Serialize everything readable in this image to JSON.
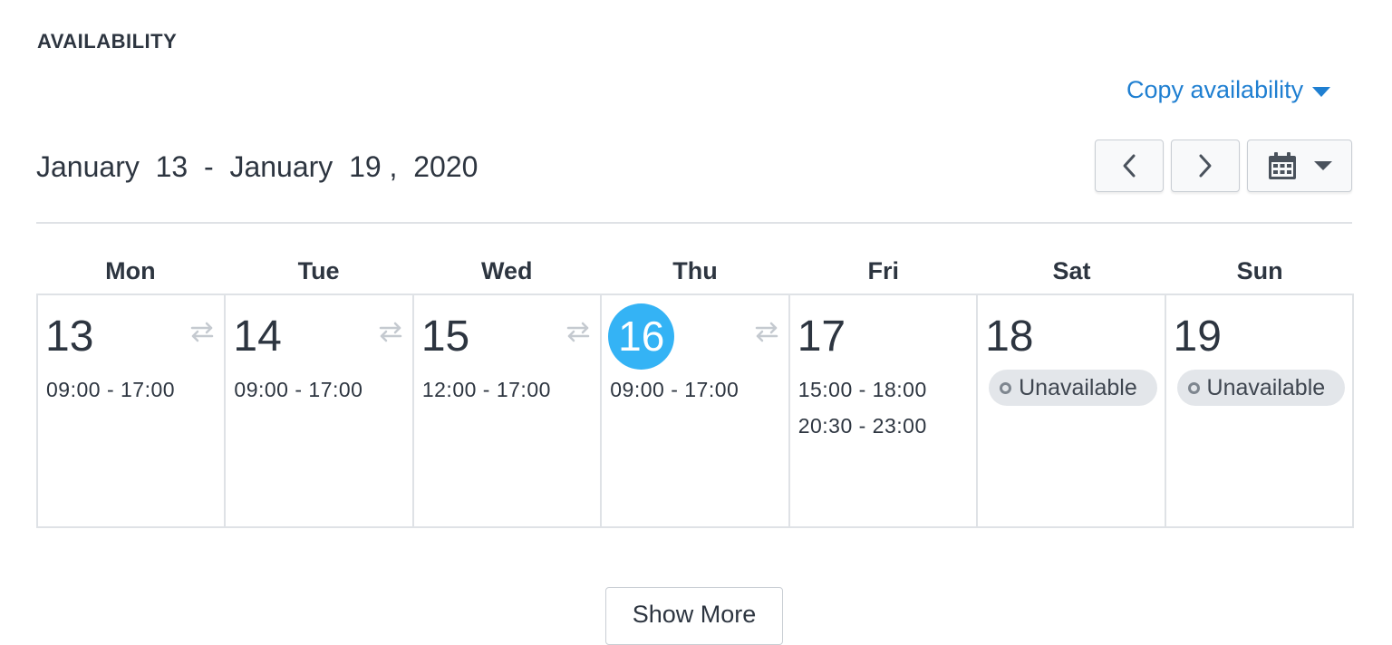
{
  "section_title": "AVAILABILITY",
  "copy_link": {
    "label": "Copy availability"
  },
  "date_range": "January  13  -  January  19 ,  2020",
  "icons": {
    "prev": "chevron-left-icon",
    "next": "chevron-right-icon",
    "calendar": "calendar-icon",
    "dropdown": "caret-down-icon",
    "repeat": "repeat-icon",
    "unavailable": "circle-outline-icon"
  },
  "colors": {
    "accent": "#1f7fd1",
    "today": "#34b3f5",
    "text": "#2d3540",
    "border": "#dfe2e6",
    "badge_bg": "#e3e6ea"
  },
  "days": [
    {
      "name": "Mon",
      "date": "13",
      "today": false,
      "repeat": true,
      "slots": [
        "09:00 - 17:00"
      ],
      "unavailable": ""
    },
    {
      "name": "Tue",
      "date": "14",
      "today": false,
      "repeat": true,
      "slots": [
        "09:00 - 17:00"
      ],
      "unavailable": ""
    },
    {
      "name": "Wed",
      "date": "15",
      "today": false,
      "repeat": true,
      "slots": [
        "12:00 - 17:00"
      ],
      "unavailable": ""
    },
    {
      "name": "Thu",
      "date": "16",
      "today": true,
      "repeat": true,
      "slots": [
        "09:00 - 17:00"
      ],
      "unavailable": ""
    },
    {
      "name": "Fri",
      "date": "17",
      "today": false,
      "repeat": false,
      "slots": [
        "15:00 - 18:00",
        "20:30 - 23:00"
      ],
      "unavailable": ""
    },
    {
      "name": "Sat",
      "date": "18",
      "today": false,
      "repeat": false,
      "slots": [],
      "unavailable": "Unavailable"
    },
    {
      "name": "Sun",
      "date": "19",
      "today": false,
      "repeat": false,
      "slots": [],
      "unavailable": "Unavailable"
    }
  ],
  "show_more": "Show More"
}
